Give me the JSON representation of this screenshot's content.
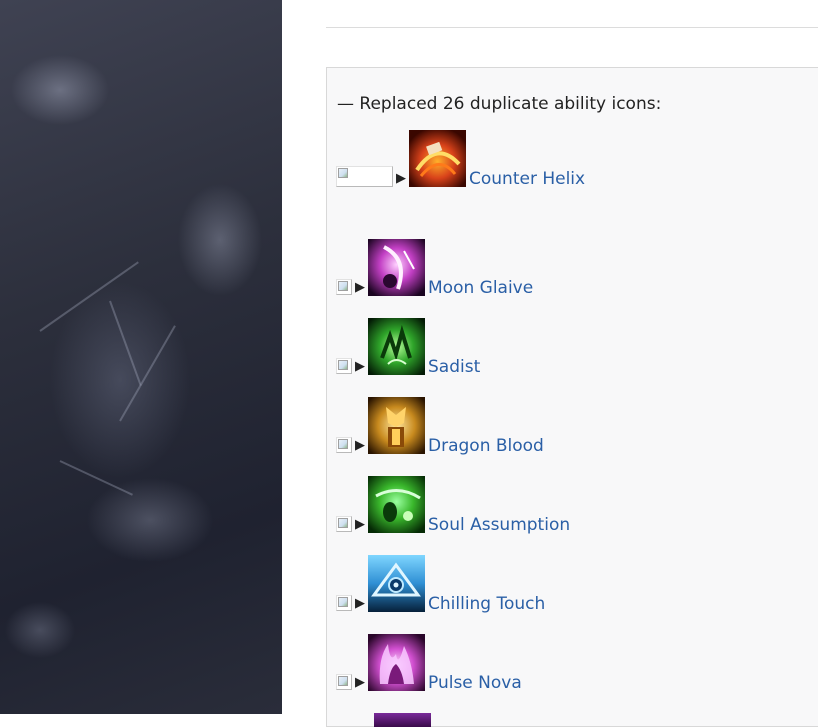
{
  "changelog": {
    "intro": "— Replaced 26 duplicate ability icons:",
    "arrow_glyph": "▶",
    "items": [
      {
        "label": "Counter Helix",
        "icon": "counter-helix-icon",
        "color": "#d8421a"
      },
      {
        "label": "Moon Glaive",
        "icon": "moon-glaive-icon",
        "color": "#c23fc4"
      },
      {
        "label": "Sadist",
        "icon": "sadist-icon",
        "color": "#2fa52a"
      },
      {
        "label": "Dragon Blood",
        "icon": "dragon-blood-icon",
        "color": "#c88a1e"
      },
      {
        "label": "Soul Assumption",
        "icon": "soul-assumption-icon",
        "color": "#3ab82c"
      },
      {
        "label": "Chilling Touch",
        "icon": "chilling-touch-icon",
        "color": "#2f8fd4"
      },
      {
        "label": "Pulse Nova",
        "icon": "pulse-nova-icon",
        "color": "#d14fd0"
      }
    ]
  },
  "colors": {
    "link": "#2a5fa6",
    "panel_bg": "#f8f8f9",
    "sidebar_art": "#2c2f3c"
  }
}
